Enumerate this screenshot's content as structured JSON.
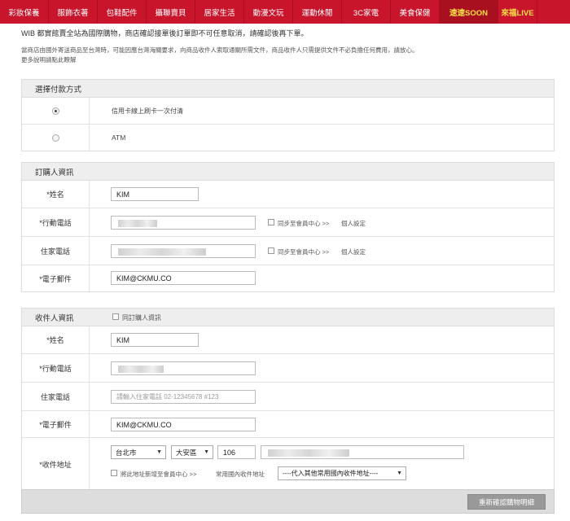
{
  "nav": [
    {
      "label": "彩妝保養",
      "w": 60
    },
    {
      "label": "服飾衣著",
      "w": 60
    },
    {
      "label": "包鞋配件",
      "w": 60
    },
    {
      "label": "攝聯賣貝",
      "w": 60
    },
    {
      "label": "居家生活",
      "w": 60
    },
    {
      "label": "動漫文玩",
      "w": 60
    },
    {
      "label": "運動休閒",
      "w": 60
    },
    {
      "label": "3C家電",
      "w": 60
    },
    {
      "label": "美食保健",
      "w": 60
    },
    {
      "label": "速速SOON",
      "w": 72
    },
    {
      "label": "來福LIVE",
      "w": 48
    }
  ],
  "notice": {
    "line1": "WIB 都實館賣全站為國際購物，商店確認接單後訂單即不可任意取消，請確認後再下單。",
    "line2": "當商店由國外寄送商品至台灣時，可能因應台灣海關要求，向商品收件人索取通關所需文件，商品收件人只需提供文件不必負擔任何費用，請放心。",
    "link": "更多說明請點此瞭解"
  },
  "payment": {
    "title": "選擇付款方式",
    "options": [
      "信用卡線上刷卡一次付清",
      "ATM"
    ],
    "selected": 0
  },
  "buyer": {
    "title": "訂購人資訊",
    "name_label": "*姓名",
    "name_value": "KIM",
    "mobile_label": "*行動電話",
    "home_label": "住家電話",
    "email_label": "*電子郵件",
    "email_value": "KIM@CKMU.CO",
    "sync_text": "同步至會員中心 >>",
    "settings_link": "個人設定"
  },
  "receiver": {
    "title": "收件人資訊",
    "same_as_buyer": "同訂購人資訊",
    "name_label": "*姓名",
    "name_value": "KIM",
    "mobile_label": "*行動電話",
    "home_label": "住家電話",
    "home_placeholder": "請輸入住家電話 02-12345678 #123",
    "email_label": "*電子郵件",
    "email_value": "KIM@CKMU.CO",
    "address_label": "*收件地址",
    "city": "台北市",
    "district": "大安區",
    "zip": "106",
    "add_address_text": "將此地址新增至會員中心 >>",
    "address_book_link": "常用國內收件地址",
    "address_book_select": "----代入其他常用國內收件地址----"
  },
  "confirm_button": "重新確認購物明細"
}
